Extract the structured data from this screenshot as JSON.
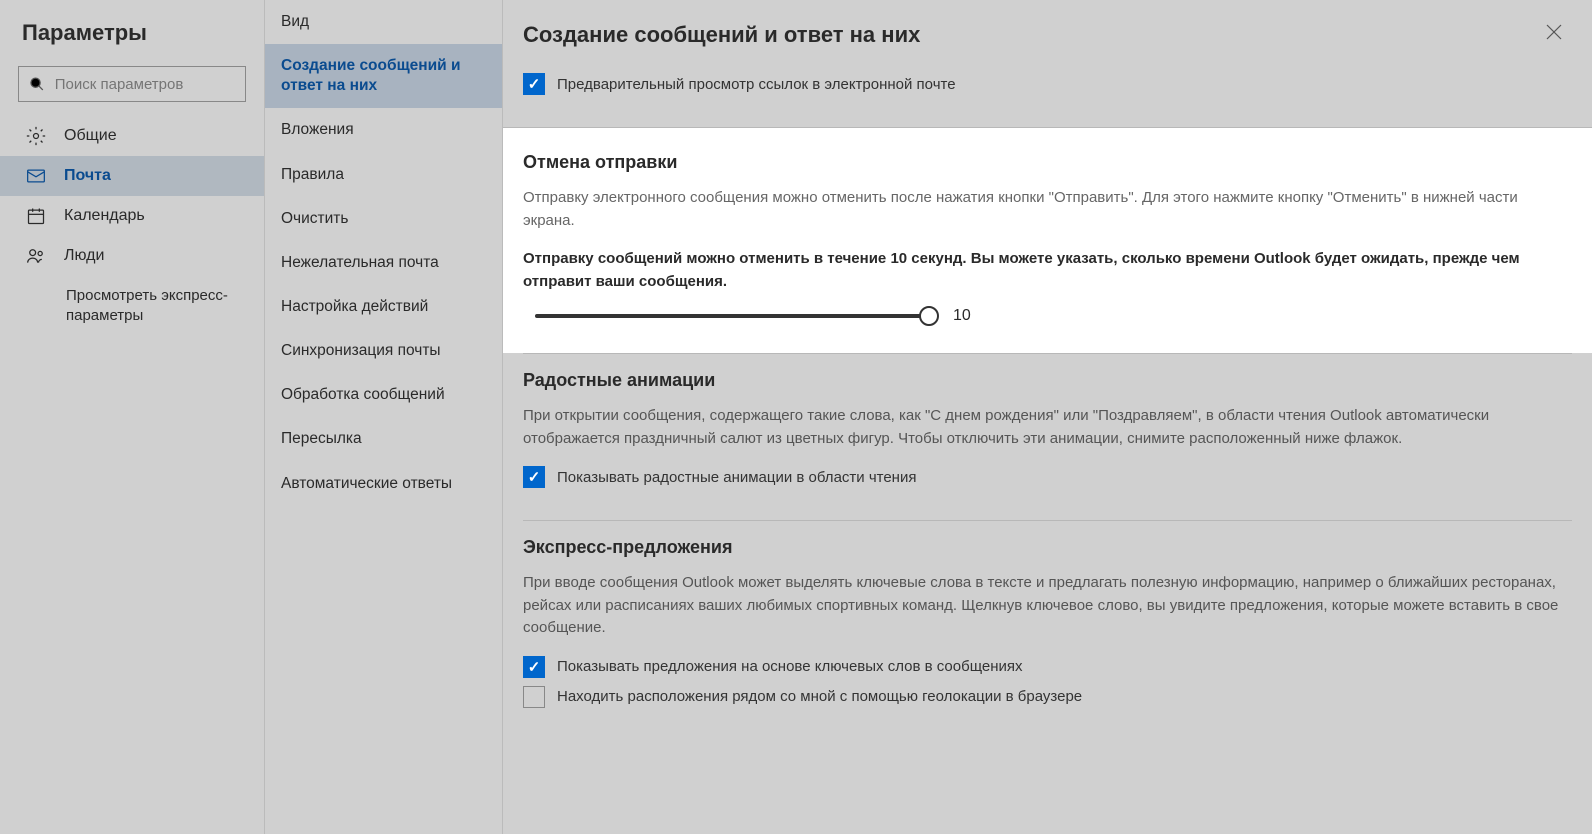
{
  "sidebar": {
    "title": "Параметры",
    "search_placeholder": "Поиск параметров",
    "categories": [
      {
        "key": "general",
        "label": "Общие"
      },
      {
        "key": "mail",
        "label": "Почта"
      },
      {
        "key": "calendar",
        "label": "Календарь"
      },
      {
        "key": "people",
        "label": "Люди"
      }
    ],
    "quick_settings": "Просмотреть экспресс-параметры"
  },
  "subnav": {
    "items": [
      "Вид",
      "Создание сообщений и ответ на них",
      "Вложения",
      "Правила",
      "Очистить",
      "Нежелательная почта",
      "Настройка действий",
      "Синхронизация почты",
      "Обработка сообщений",
      "Пересылка",
      "Автоматические ответы"
    ]
  },
  "main": {
    "title": "Создание сообщений и ответ на них",
    "section_preview": {
      "checkbox_label": "Предварительный просмотр ссылок в электронной почте"
    },
    "section_undo": {
      "title": "Отмена отправки",
      "desc": "Отправку электронного сообщения можно отменить после нажатия кнопки \"Отправить\". Для этого нажмите кнопку \"Отменить\" в нижней части экрана.",
      "bold": "Отправку сообщений можно отменить в течение 10 секунд. Вы можете указать, сколько времени Outlook будет ожидать, прежде чем отправит ваши сообщения.",
      "value": "10"
    },
    "section_joyful": {
      "title": "Радостные анимации",
      "desc": "При открытии сообщения, содержащего такие слова, как \"С днем рождения\" или \"Поздравляем\", в области чтения Outlook автоматически отображается праздничный салют из цветных фигур. Чтобы отключить эти анимации, снимите расположенный ниже флажок.",
      "checkbox_label": "Показывать радостные анимации в области чтения"
    },
    "section_suggest": {
      "title": "Экспресс-предложения",
      "desc": "При вводе сообщения Outlook может выделять ключевые слова в тексте и предлагать полезную информацию, например о ближайших ресторанах, рейсах или расписаниях ваших любимых спортивных команд. Щелкнув ключевое слово, вы увидите предложения, которые можете вставить в свое сообщение.",
      "checkbox1_label": "Показывать предложения на основе ключевых слов в сообщениях",
      "checkbox2_label": "Находить расположения рядом со мной с помощью геолокации в браузере"
    }
  }
}
